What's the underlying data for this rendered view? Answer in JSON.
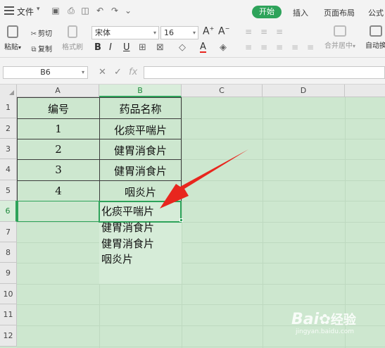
{
  "menubar": {
    "file_label": "文件",
    "tabs": {
      "start": "开始",
      "insert": "插入",
      "page_layout": "页面布局",
      "formula": "公式"
    }
  },
  "ribbon": {
    "paste_label": "粘贴",
    "cut_label": "剪切",
    "copy_label": "复制",
    "format_painter_label": "格式刷",
    "font_name": "宋体",
    "font_size": "16",
    "merge_center_label": "合并居中",
    "auto_wrap_label": "自动换"
  },
  "formula_bar": {
    "name_box": "B6",
    "content": ""
  },
  "columns": [
    "A",
    "B",
    "C",
    "D"
  ],
  "rows": [
    "1",
    "2",
    "3",
    "4",
    "5",
    "6",
    "7",
    "8",
    "9",
    "10",
    "11",
    "12"
  ],
  "table": {
    "headers": [
      "编号",
      "药品名称"
    ],
    "rows": [
      [
        "1",
        "化痰平喘片"
      ],
      [
        "2",
        "健胃消食片"
      ],
      [
        "3",
        "健胃消食片"
      ],
      [
        "4",
        "咽炎片"
      ]
    ]
  },
  "active_cell_content": [
    "化痰平喘片",
    "健胃消食片",
    "健胃消食片",
    "咽炎片"
  ],
  "watermark": {
    "main": "Bai",
    "brand": "经验",
    "url": "jingyan.baidu.com"
  },
  "colors": {
    "accent": "#2ea35a",
    "sheet_bg": "#cde7cf",
    "arrow": "#e8261e"
  }
}
